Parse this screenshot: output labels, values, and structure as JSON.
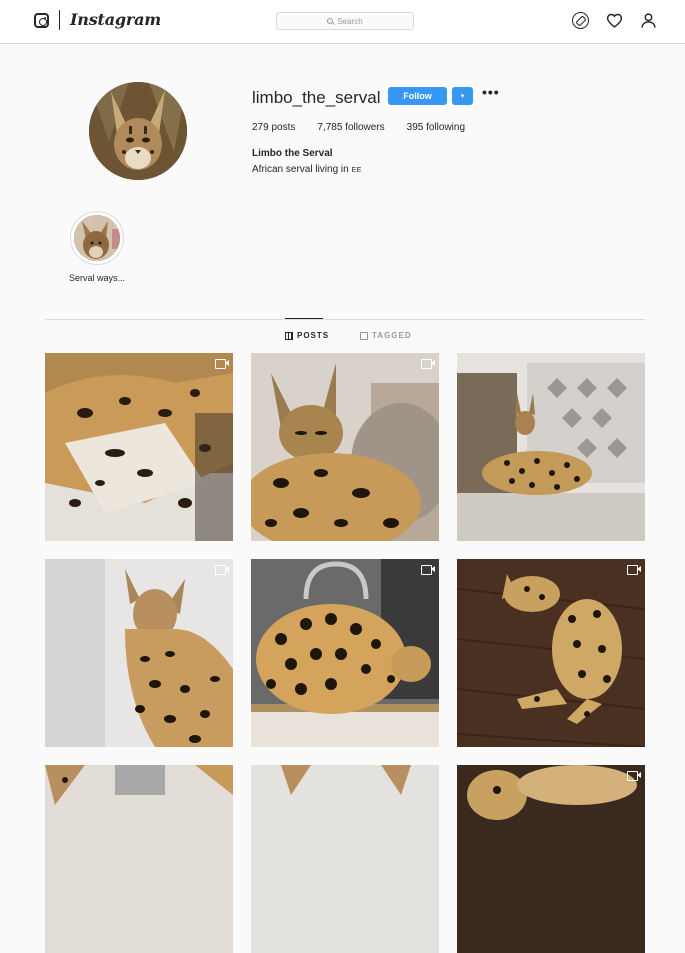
{
  "nav": {
    "wordmark": "Instagram",
    "search_placeholder": "Search",
    "icons": [
      "instagram-logo-icon",
      "compass-icon",
      "heart-icon",
      "user-icon"
    ]
  },
  "profile": {
    "username": "limbo_the_serval",
    "follow_label": "Follow",
    "dropdown_label": "▾",
    "more_label": "•••",
    "stats": {
      "posts": "279 posts",
      "followers": "7,785 followers",
      "following": "395 following"
    },
    "full_name": "Limbo the Serval",
    "bio_text": "African serval living in ",
    "bio_flag": "EE"
  },
  "highlights": [
    {
      "label": "Serval ways..."
    }
  ],
  "tabs": {
    "posts_label": "POSTS",
    "tagged_label": "TAGGED"
  },
  "posts": [
    {
      "type": "video"
    },
    {
      "type": "video"
    },
    {
      "type": "video"
    },
    {
      "type": "video"
    },
    {
      "type": "video"
    },
    {
      "type": "video"
    },
    {
      "type": "image"
    },
    {
      "type": "image"
    },
    {
      "type": "video"
    }
  ],
  "colors": {
    "accent": "#3897f0",
    "background": "#fafafa",
    "border": "#dbdbdb",
    "text": "#262626",
    "muted": "#999999"
  }
}
